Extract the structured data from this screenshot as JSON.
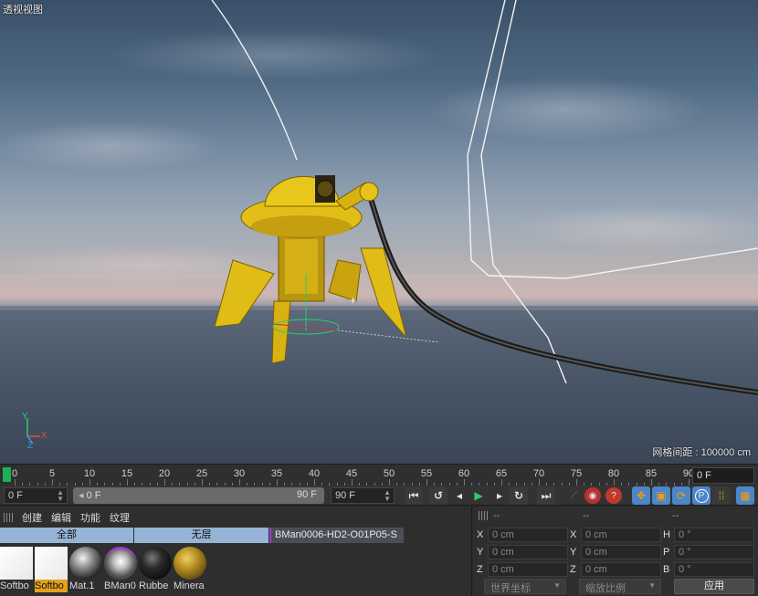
{
  "viewport": {
    "title": "透视视图",
    "grid_distance": "网格间距 : 100000 cm",
    "axis_labels": {
      "x": "X",
      "y": "Y",
      "z": "Z"
    }
  },
  "timeline": {
    "ticks": [
      "0",
      "5",
      "10",
      "15",
      "20",
      "25",
      "30",
      "35",
      "40",
      "45",
      "50",
      "55",
      "60",
      "65",
      "70",
      "75",
      "80",
      "85",
      "90"
    ],
    "current_frame": "0 F"
  },
  "transport": {
    "start_frame": "0 F",
    "range_start": "0 F",
    "range_end": "90 F",
    "end_frame": "90 F",
    "buttons": [
      {
        "name": "goto-start-icon",
        "glyph": "⏮"
      },
      {
        "name": "prev-keyframe-icon",
        "glyph": "⟲"
      },
      {
        "name": "prev-frame-icon",
        "glyph": "◀"
      },
      {
        "name": "play-icon",
        "glyph": "▶"
      },
      {
        "name": "next-frame-icon",
        "glyph": "▶"
      },
      {
        "name": "next-keyframe-icon",
        "glyph": "⟳"
      },
      {
        "name": "goto-end-icon",
        "glyph": "⏭"
      }
    ]
  },
  "materials": {
    "menu": [
      "创建",
      "编辑",
      "功能",
      "纹理"
    ],
    "layers": {
      "all": "全部",
      "none": "无层",
      "scene": "BMan0006-HD2-O01P05-S"
    },
    "items": [
      {
        "label": "Softbo",
        "kind": "white",
        "selected": false
      },
      {
        "label": "Softbo",
        "kind": "white",
        "selected": true
      },
      {
        "label": "Mat.1",
        "kind": "chrome",
        "selected": false
      },
      {
        "label": "BMan0",
        "kind": "robot",
        "selected": false
      },
      {
        "label": "Rubbe",
        "kind": "black",
        "selected": false
      },
      {
        "label": "Minera",
        "kind": "gold",
        "selected": false
      }
    ]
  },
  "coords": {
    "headers": [
      "--",
      "--",
      "--"
    ],
    "rows": [
      {
        "a": "X",
        "av": "0 cm",
        "b": "X",
        "bv": "0 cm",
        "c": "H",
        "cv": "0 °"
      },
      {
        "a": "Y",
        "av": "0 cm",
        "b": "Y",
        "bv": "0 cm",
        "c": "P",
        "cv": "0 °"
      },
      {
        "a": "Z",
        "av": "0 cm",
        "b": "Z",
        "bv": "0 cm",
        "c": "B",
        "cv": "0 °"
      }
    ],
    "coord_system": "世界坐标",
    "scale_mode": "缩放比例",
    "apply": "应用"
  },
  "colors": {
    "accent_selected": "#e4a21b",
    "layer_bar": "#96b4d6",
    "playhead": "#1db05a",
    "robot_gold": "#e6c21a"
  }
}
